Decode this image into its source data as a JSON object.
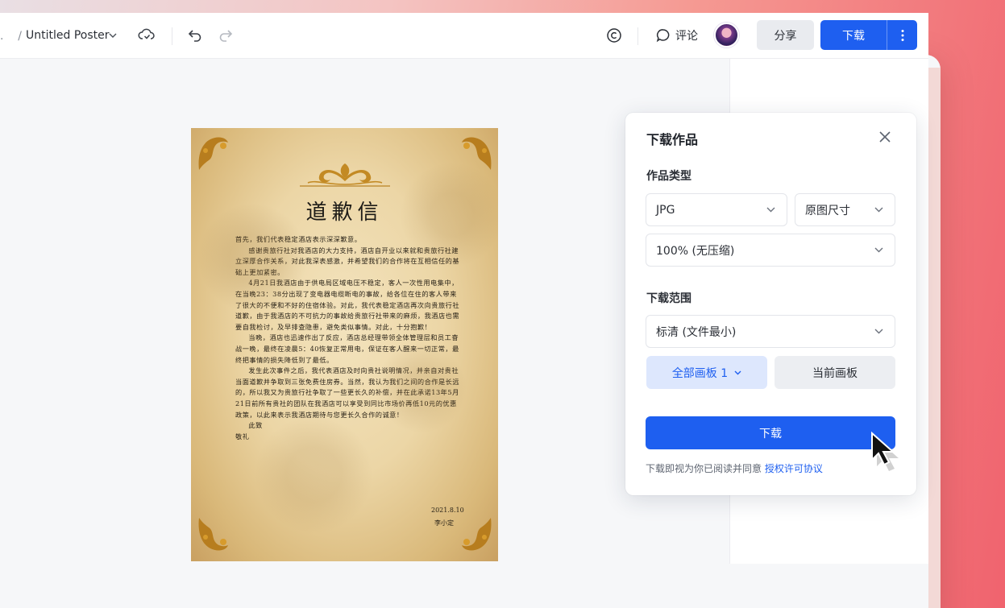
{
  "toolbar": {
    "crumb_sep": "/",
    "crumb_dot": ".",
    "title": "Untitled Poster",
    "comment_label": "评论",
    "share_label": "分享",
    "download_label": "下载"
  },
  "poster": {
    "heading": "道歉信",
    "paragraphs": [
      "首先，我们代表稳定酒店表示深深歉意。",
      "感谢贵旅行社对我酒店的大力支持，酒店自开业以来就和贵旅行社建立深厚合作关系，对此我深表感激，并希望我们的合作将在互相信任的基础上更加紧密。",
      "4月21日我酒店由于供电局区域电压不稳定，客人一次性用电集中，在当晚23：38分出现了变电器电缆断电的事故，给各位在住的客人带来了很大的不便和不好的住宿体验。对此，我代表稳定酒店再次向贵旅行社道歉，由于我酒店的不可抗力的事故给贵旅行社带来的麻烦，我酒店也需要自我检讨，及早排查隐患，避免类似事情。对此，十分抱歉！",
      "当晚，酒店也迅速作出了反应，酒店总经理带领全体管理层和员工奋战一晚，最终在凌晨5：40恢复正常用电，保证在客人醒来一切正常，最终把事情的损失降低到了最低。",
      "发生此次事件之后，我代表酒店及时向贵社说明情况，并亲自对贵社当面道歉并争取到三张免费住房券。当然，我认为我们之间的合作是长远的，所以我又为贵旅行社争取了一些更长久的补偿，并在此承诺13年5月21日前所有贵社的团队在我酒店可以享受到同比市场价再低10元的优惠政策，以此来表示我酒店期待与您更长久合作的诚意！",
      "此致",
      "敬礼"
    ],
    "date": "2021.8.10",
    "signature": "李小定"
  },
  "dialog": {
    "title": "下载作品",
    "type_label": "作品类型",
    "format_value": "JPG",
    "size_value": "原图尺寸",
    "quality_value": "100% (无压缩)",
    "range_label": "下载范围",
    "clarity_value": "标清 (文件最小)",
    "all_boards_label": "全部画板 1",
    "current_board_label": "当前画板",
    "download_button": "下载",
    "agreement_prefix": "下载即视为你已阅读并同意",
    "agreement_link": "授权许可协议"
  },
  "colors": {
    "accent": "#1e5ff0",
    "accent_soft": "#dde7fd"
  }
}
